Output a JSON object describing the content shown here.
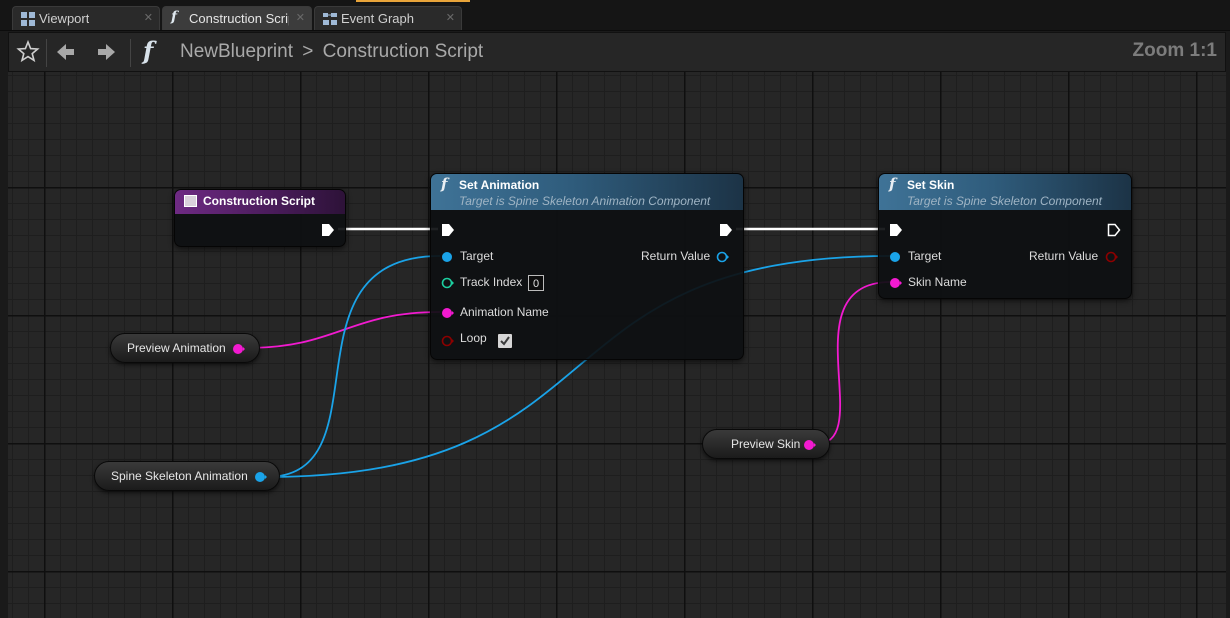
{
  "tabs": [
    {
      "label": "Viewport",
      "icon": "viewport-icon"
    },
    {
      "label": "Construction Scrip",
      "icon": "function-icon"
    },
    {
      "label": "Event Graph",
      "icon": "event-graph-icon"
    }
  ],
  "toolbar": {
    "breadcrumb_root": "NewBlueprint",
    "breadcrumb_separator": ">",
    "breadcrumb_current": "Construction Script",
    "zoom_label": "Zoom 1:1",
    "icons": [
      "star-icon",
      "back-arrow-icon",
      "forward-arrow-icon",
      "function-icon"
    ]
  },
  "nodes": {
    "construction_script": {
      "title": "Construction Script"
    },
    "set_animation": {
      "title": "Set Animation",
      "subtitle": "Target is Spine Skeleton Animation Component",
      "pins": {
        "target": "Target",
        "track_index": "Track Index",
        "track_index_value": "0",
        "animation_name": "Animation Name",
        "loop": "Loop",
        "loop_checked": true,
        "return_value": "Return Value"
      }
    },
    "set_skin": {
      "title": "Set Skin",
      "subtitle": "Target is Spine Skeleton Component",
      "pins": {
        "target": "Target",
        "skin_name": "Skin Name",
        "return_value": "Return Value"
      }
    }
  },
  "variables": {
    "preview_animation": "Preview Animation",
    "spine_skeleton_animation": "Spine Skeleton Animation",
    "preview_skin": "Preview Skin"
  },
  "colors": {
    "exec": "#ffffff",
    "object_pin": "#1aa3e8",
    "string_pin": "#f21ad0",
    "int_pin": "#1ccfa0",
    "bool_pin": "#8c0000",
    "function_header": "#3f7397",
    "event_header": "#6e2a83"
  }
}
